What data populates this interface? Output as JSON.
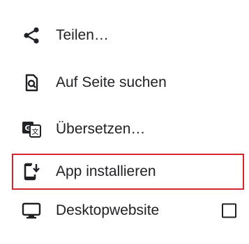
{
  "menu": {
    "items": [
      {
        "label": "Teilen…",
        "icon": "share-icon"
      },
      {
        "label": "Auf Seite suchen",
        "icon": "find-in-page-icon"
      },
      {
        "label": "Übersetzen…",
        "icon": "translate-icon"
      },
      {
        "label": "App installieren",
        "icon": "install-app-icon"
      },
      {
        "label": "Desktopwebsite",
        "icon": "desktop-icon",
        "checkbox_checked": false
      }
    ],
    "highlight_color": "#d4262e",
    "text_color": "#202124"
  }
}
